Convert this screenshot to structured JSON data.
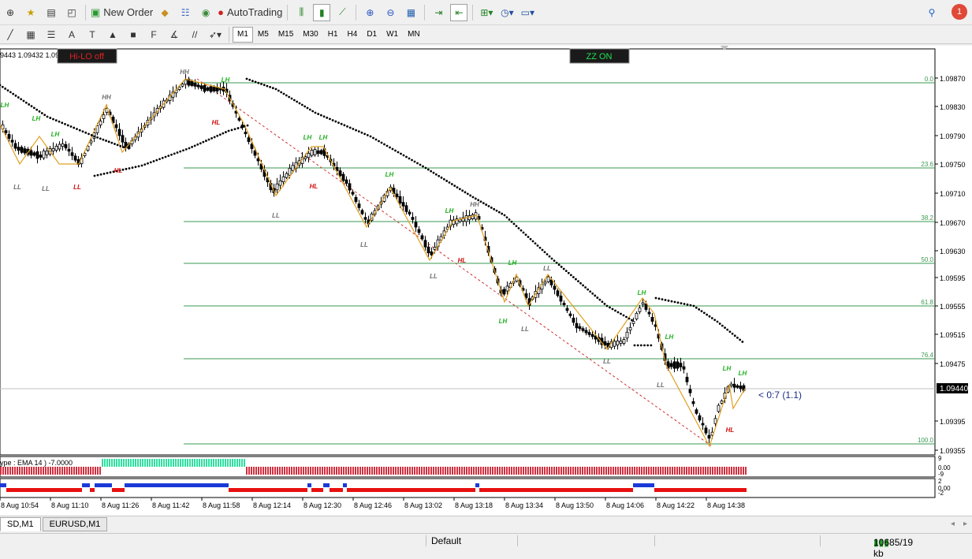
{
  "toolbar": {
    "new_order": "New Order",
    "autotrading": "AutoTrading",
    "notifications": "1",
    "timeframes": [
      "M1",
      "M5",
      "M15",
      "M30",
      "H1",
      "H4",
      "D1",
      "W1",
      "MN"
    ],
    "active_timeframe": "M1"
  },
  "chart": {
    "quote_header": "9443 1.09432 1.09",
    "hilo_button": "Hi-LO off",
    "zz_button": "ZZ ON",
    "current_price": "1.09440",
    "price_ticks": [
      "1.09870",
      "1.09830",
      "1.09790",
      "1.09750",
      "1.09710",
      "1.09670",
      "1.09630",
      "1.09595",
      "1.09555",
      "1.09515",
      "1.09475",
      "1.09440",
      "1.09395",
      "1.09355"
    ],
    "fib_levels": [
      "0.0",
      "23.6",
      "38.2",
      "50.0",
      "61.8",
      "76.4",
      "100.0"
    ],
    "fib_annotation": "< 0:7 (1.1)",
    "swing_labels": [
      {
        "t": "LH",
        "c": "green"
      },
      {
        "t": "LH",
        "c": "green"
      },
      {
        "t": "LH",
        "c": "green"
      },
      {
        "t": "HH",
        "c": "gray"
      },
      {
        "t": "HH",
        "c": "gray"
      },
      {
        "t": "LH",
        "c": "green"
      },
      {
        "t": "HL",
        "c": "red"
      },
      {
        "t": "LL",
        "c": "gray"
      },
      {
        "t": "LL",
        "c": "gray"
      },
      {
        "t": "LL",
        "c": "red"
      },
      {
        "t": "HL",
        "c": "red"
      },
      {
        "t": "LH",
        "c": "green"
      },
      {
        "t": "LH",
        "c": "green"
      },
      {
        "t": "HL",
        "c": "red"
      },
      {
        "t": "LL",
        "c": "gray"
      },
      {
        "t": "LH",
        "c": "green"
      },
      {
        "t": "LL",
        "c": "gray"
      },
      {
        "t": "LH",
        "c": "green"
      },
      {
        "t": "HH",
        "c": "gray"
      },
      {
        "t": "HL",
        "c": "red"
      },
      {
        "t": "LL",
        "c": "gray"
      },
      {
        "t": "LH",
        "c": "green"
      },
      {
        "t": "LH",
        "c": "green"
      },
      {
        "t": "LL",
        "c": "gray"
      },
      {
        "t": "LL",
        "c": "gray"
      },
      {
        "t": "LH",
        "c": "green"
      },
      {
        "t": "LL",
        "c": "gray"
      },
      {
        "t": "LH",
        "c": "green"
      },
      {
        "t": "LL",
        "c": "gray"
      },
      {
        "t": "LH",
        "c": "green"
      },
      {
        "t": "LH",
        "c": "green"
      },
      {
        "t": "HL",
        "c": "red"
      }
    ],
    "indicator1_label": "ype : EMA  14 ) -7.0000",
    "indicator1_ticks": [
      "9",
      "0.00",
      "-9"
    ],
    "indicator2_ticks": [
      "2",
      "0.00",
      "-2"
    ],
    "time_ticks": [
      "8 Aug 10:54",
      "8 Aug 11:10",
      "8 Aug 11:26",
      "8 Aug 11:42",
      "8 Aug 11:58",
      "8 Aug 12:14",
      "8 Aug 12:30",
      "8 Aug 12:46",
      "8 Aug 13:02",
      "8 Aug 13:18",
      "8 Aug 13:34",
      "8 Aug 13:50",
      "8 Aug 14:06",
      "8 Aug 14:22",
      "8 Aug 14:38"
    ]
  },
  "tabs": [
    "SD,M1",
    "EURUSD,M1"
  ],
  "status": {
    "profile": "Default",
    "traffic": "10685/19 kb"
  },
  "colors": {
    "up_candle": "#ffffff",
    "down_candle": "#000000",
    "zigzag": "#e0a020",
    "fib": "#3a9a50",
    "bull": "#2ee0a0",
    "bear": "#d03040",
    "blue": "#1a3ad8",
    "red": "#e81010"
  }
}
